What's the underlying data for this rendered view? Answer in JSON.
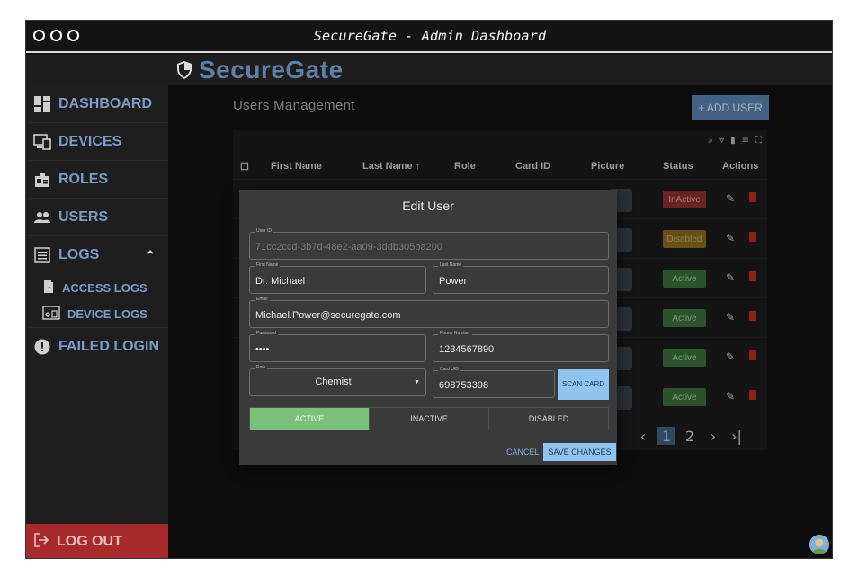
{
  "window": {
    "title": "SecureGate - Admin Dashboard"
  },
  "brand": {
    "name": "SecureGate"
  },
  "sidebar": {
    "items": [
      {
        "label": "DASHBOARD"
      },
      {
        "label": "DEVICES"
      },
      {
        "label": "ROLES"
      },
      {
        "label": "USERS"
      },
      {
        "label": "LOGS"
      }
    ],
    "sub_items": [
      {
        "label": "ACCESS LOGS"
      },
      {
        "label": "DEVICE LOGS"
      }
    ],
    "failed_login": "FAILED LOGIN",
    "logout": "LOG OUT"
  },
  "main": {
    "title": "Users Management",
    "add_user": "+ ADD USER",
    "columns": [
      "First Name",
      "Last Name ↑",
      "Role",
      "Card ID",
      "Picture",
      "Status",
      "Actions"
    ],
    "rows": [
      {
        "status": "InActive",
        "kind": "inactive"
      },
      {
        "status": "Disabled",
        "kind": "disabled"
      },
      {
        "status": "Active",
        "kind": "active"
      },
      {
        "status": "Active",
        "kind": "active"
      },
      {
        "status": "Active",
        "kind": "active"
      },
      {
        "status": "Active",
        "kind": "active"
      }
    ],
    "pagination": {
      "pages": [
        "1",
        "2"
      ],
      "current": "1"
    }
  },
  "modal": {
    "title": "Edit User",
    "user_id": {
      "label": "User ID",
      "value": "71cc2ccd-3b7d-48e2-aa09-3ddb305ba200"
    },
    "first_name": {
      "label": "First Name",
      "value": "Dr. Michael"
    },
    "last_name": {
      "label": "Last Name",
      "value": "Power"
    },
    "email": {
      "label": "Email",
      "value": "Michael.Power@securegate.com"
    },
    "password": {
      "label": "Password",
      "value": "••••"
    },
    "phone": {
      "label": "Phone Number",
      "value": "1234567890"
    },
    "role": {
      "label": "Role",
      "value": "Chemist"
    },
    "card_uid": {
      "label": "Card UID",
      "value": "698753398"
    },
    "scan_card": "SCAN CARD",
    "status_options": [
      "ACTIVE",
      "INACTIVE",
      "DISABLED"
    ],
    "selected_status": "ACTIVE",
    "cancel": "CANCEL",
    "save": "SAVE CHANGES"
  },
  "colors": {
    "brand": "#5f7ea3",
    "accent": "#90c4f0",
    "active": "#7ac07a",
    "danger": "#c62828",
    "logout_bg": "#a82b2b"
  }
}
